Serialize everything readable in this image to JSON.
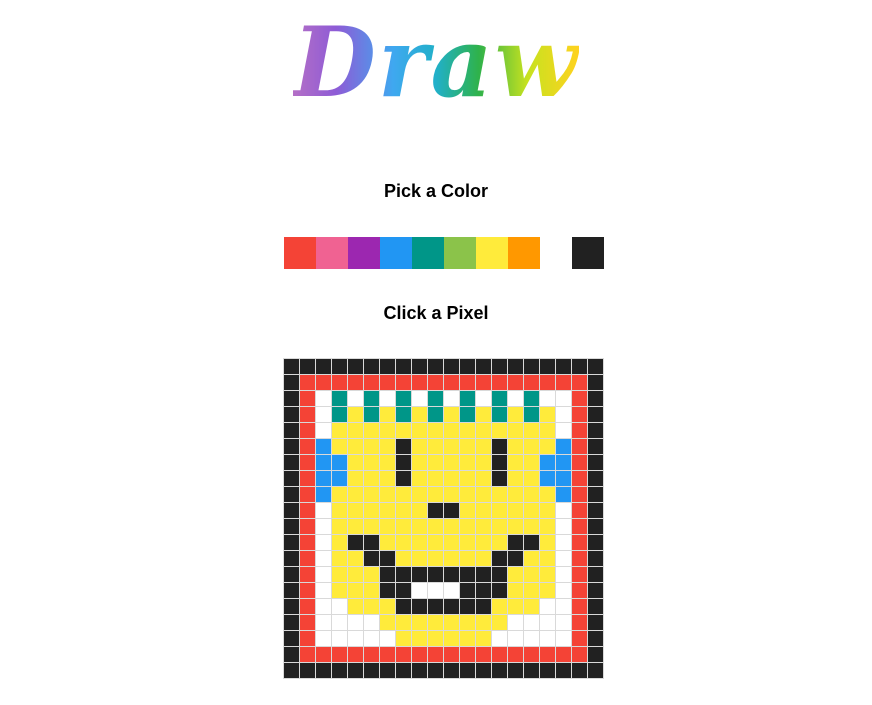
{
  "header": {
    "title": "Draw"
  },
  "sections": {
    "pick_color": "Pick a Color",
    "click_pixel": "Click a Pixel"
  },
  "palette": [
    {
      "name": "red",
      "hex": "#f44336"
    },
    {
      "name": "pink",
      "hex": "#f06292"
    },
    {
      "name": "purple",
      "hex": "#9c27b0"
    },
    {
      "name": "blue",
      "hex": "#2196f3"
    },
    {
      "name": "teal",
      "hex": "#009688"
    },
    {
      "name": "green",
      "hex": "#8bc34a"
    },
    {
      "name": "yellow",
      "hex": "#ffeb3b"
    },
    {
      "name": "orange",
      "hex": "#ff9800"
    },
    {
      "name": "white",
      "hex": "#ffffff"
    },
    {
      "name": "black",
      "hex": "#212121"
    }
  ],
  "canvas": {
    "columns": 20,
    "rows": 20,
    "legend": {
      "K": "#212121",
      "R": "#f44336",
      "W": "#ffffff",
      "Y": "#ffeb3b",
      "T": "#009688",
      "B": "#2196f3"
    },
    "pixels": [
      "KKKKKKKKKKKKKKKKKKKK",
      "KRRRRRRRRRRRRRRRRRRK",
      "KRWTWTWTWTWTWTWTWWRK",
      "KRWTYTYTYTYTYTYTYWRK",
      "KRWYYYYYYYYYYYYYYWRK",
      "KRBYYYYKYYYYYKYYYBRK",
      "KRBBYYYKYYYYYKYYBBRK",
      "KRBBYYYKYYYYYKYYBBRK",
      "KRBYYYYYYYYYYYYYYBRK",
      "KRWYYYYYYKKYYYYYYWRK",
      "KRWYYYYYYYYYYYYYYWRK",
      "KRWYKKYYYYYYYYKKYWRK",
      "KRWYYKKYYYYYYKKYYWRK",
      "KRWYYYKKKKKKKKYYYWRK",
      "KRWYYYKKWWWKKKYYYWRK",
      "KRWWYYYKKKKKKYYYWWRK",
      "KRWWWWYYYYYYYYWWWWRK",
      "KRWWWWWYYYYYYWWWWWRK",
      "KRRRRRRRRRRRRRRRRRRK",
      "KKKKKKKKKKKKKKKKKKKK"
    ]
  }
}
